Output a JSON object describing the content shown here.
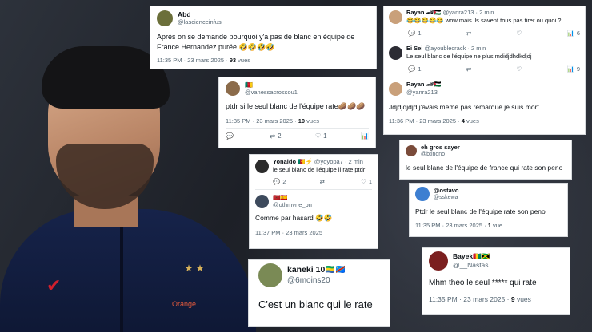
{
  "t1": {
    "name": "Abd",
    "handle": "@lascienceinfus",
    "text": "Après on se demande pourquoi y'a pas de blanc en équipe de France Hernandez purée 🤣🤣🤣🤣",
    "time": "11:35 PM · 23 mars 2025 · ",
    "views_count": "93",
    "views_label": " vues"
  },
  "t2": {
    "flags": "🇨🇲",
    "handle": "@vanessacrossou1",
    "text": "ptdr si le seul blanc de l'équipe rate🥔🥔🥔",
    "time": "11:35 PM · 23 mars 2025 · ",
    "views_count": "10",
    "views_label": " vues",
    "reply": "",
    "retweet": "2",
    "like": "1"
  },
  "t3": {
    "top": {
      "name": "Yonaldo",
      "badges": "🇨🇲⚡",
      "handle": "@yoyopa7 · 2 min",
      "text": "le seul blanc de l'équipe il rate ptdr",
      "reply": "2",
      "retweet": "",
      "like": "1"
    },
    "bottom": {
      "flags": "🇲🇦🇪🇸",
      "handle": "@othmvne_bn",
      "text": "Comme par hasard 🤣🤣",
      "time": "11:37 PM · 23 mars 2025"
    }
  },
  "t4": {
    "name": "kaneki 10",
    "badges": "🇬🇦🇨🇩",
    "handle": "@6moins20",
    "text": "C'est un blanc qui le rate"
  },
  "t5": {
    "first": {
      "name": "Rayan 🏎🇵🇸",
      "handle": "@yanra213 · 2 min",
      "text": "😂😂😂😂😂 wow mais ils savent tous pas tirer ou quoi ?",
      "reply": "1",
      "retweet": "",
      "like": "",
      "views": "6"
    },
    "second": {
      "name": "Ei Sei",
      "handle": "@ayoublecrack · 2 min",
      "text": "Le seul blanc de l'équipe ne plus mdidjdhdkdjdj",
      "reply": "1",
      "retweet": "",
      "like": "",
      "views": "9"
    },
    "third": {
      "name": "Rayan 🏎🇵🇸",
      "handle": "@yanra213",
      "text": "Jdjdjdjdjd j'avais même pas remarqué je suis mort",
      "time": "11:36 PM · 23 mars 2025 · ",
      "views_count": "4",
      "views_label": " vues"
    }
  },
  "t6": {
    "name": "eh gros sayer",
    "handle": "@btlnono",
    "text": "le seul blanc de l'équipe de france qui rate son peno"
  },
  "t7": {
    "name": "@ostavo",
    "handle": "@sskewa",
    "text": "Ptdr le seul blanc de l'équipe rate son peno",
    "time": "11:35 PM · 23 mars 2025 · ",
    "views_count": "1",
    "views_label": " vue"
  },
  "t8": {
    "name": "Bayek",
    "badges": "🇬🇳🇯🇲",
    "handle": "@__Nastas",
    "text": "Mhm theo le seul ***** qui rate",
    "time": "11:35 PM · 23 mars 2025 · ",
    "views_count": "9",
    "views_label": " vues"
  },
  "photo": {
    "brand": "Orange",
    "crest": "★ ★"
  },
  "icons": {
    "reply": "💬",
    "retweet": "⇄",
    "like": "♡",
    "views": "📊"
  },
  "colors": {
    "card_bg": "#ffffff",
    "text": "#0f1419",
    "muted": "#536471",
    "jersey": "#16234a",
    "swoosh": "#d21f2d"
  }
}
